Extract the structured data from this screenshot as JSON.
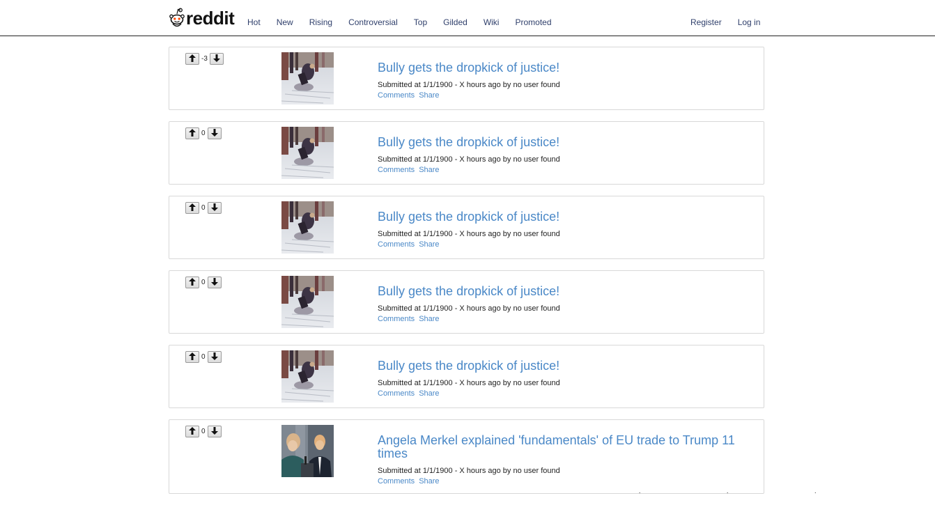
{
  "header": {
    "logo_text": "reddit",
    "nav": [
      "Hot",
      "New",
      "Rising",
      "Controversial",
      "Top",
      "Gilded",
      "Wiki",
      "Promoted"
    ],
    "register": "Register",
    "login": "Log in"
  },
  "posts": [
    {
      "score": "-3",
      "title": "Bully gets the dropkick of justice!",
      "meta": "Submitted at 1/1/1900 - X hours ago by no user found",
      "comments": "Comments",
      "share": "Share",
      "thumb": "scene"
    },
    {
      "score": "0",
      "title": "Bully gets the dropkick of justice!",
      "meta": "Submitted at 1/1/1900 - X hours ago by no user found",
      "comments": "Comments",
      "share": "Share",
      "thumb": "scene"
    },
    {
      "score": "0",
      "title": "Bully gets the dropkick of justice!",
      "meta": "Submitted at 1/1/1900 - X hours ago by no user found",
      "comments": "Comments",
      "share": "Share",
      "thumb": "scene"
    },
    {
      "score": "0",
      "title": "Bully gets the dropkick of justice!",
      "meta": "Submitted at 1/1/1900 - X hours ago by no user found",
      "comments": "Comments",
      "share": "Share",
      "thumb": "scene"
    },
    {
      "score": "0",
      "title": "Bully gets the dropkick of justice!",
      "meta": "Submitted at 1/1/1900 - X hours ago by no user found",
      "comments": "Comments",
      "share": "Share",
      "thumb": "scene"
    },
    {
      "score": "0",
      "title": "Angela Merkel explained 'fundamentals' of EU trade to Trump 11 times",
      "meta": "Submitted at 1/1/1900 - X hours ago by no user found",
      "comments": "Comments",
      "share": "Share",
      "thumb": "people"
    }
  ],
  "colors": {
    "link": "#4a88c7",
    "nav": "#2f3f6b",
    "border": "#d8d8d8"
  }
}
